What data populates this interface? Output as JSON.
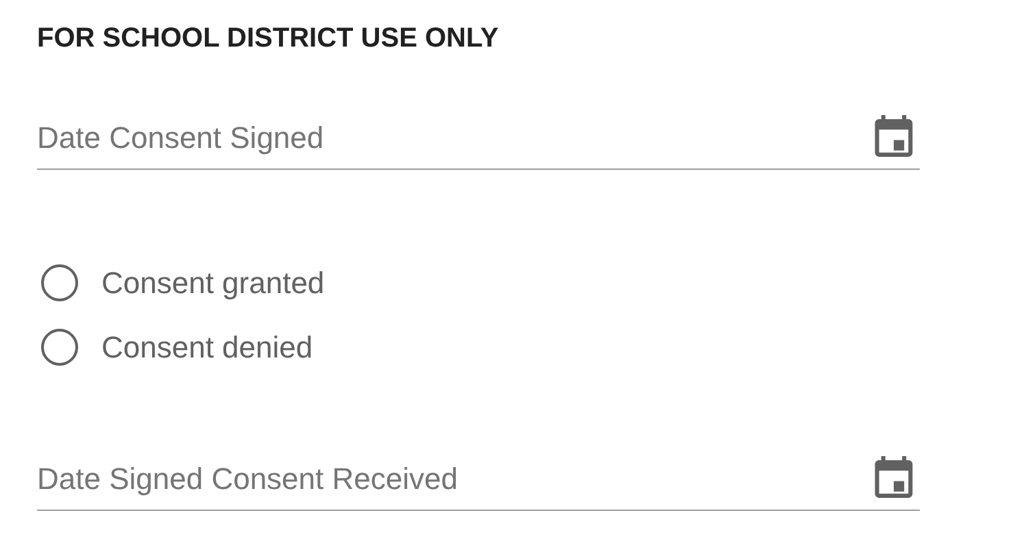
{
  "section_title": "FOR SCHOOL DISTRICT USE ONLY",
  "date_fields": [
    {
      "placeholder": "Date Consent Signed"
    },
    {
      "placeholder": "Date Signed Consent Received"
    }
  ],
  "consent_options": [
    {
      "label": "Consent granted",
      "selected": false
    },
    {
      "label": "Consent denied",
      "selected": false
    }
  ]
}
